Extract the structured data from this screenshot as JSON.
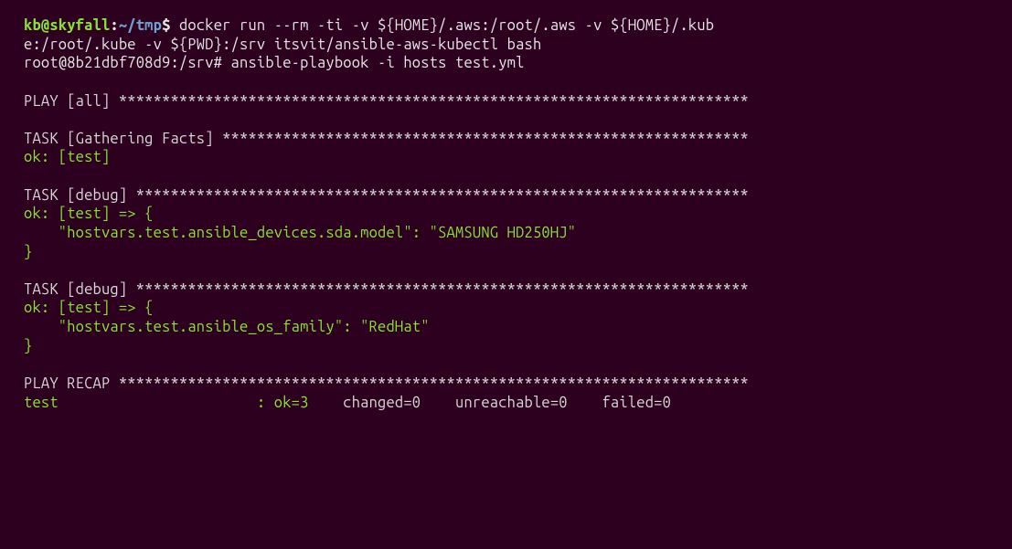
{
  "prompt1": {
    "user": "kb@skyfall",
    "sep": ":",
    "path": "~/tmp",
    "dollar": "$ ",
    "cmd_line1": "docker run --rm -ti -v ${HOME}/.aws:/root/.aws -v ${HOME}/.kub",
    "cmd_line2": "e:/root/.kube -v ${PWD}:/srv itsvit/ansible-aws-kubectl bash"
  },
  "prompt2": "root@8b21dbf708d9:/srv# ansible-playbook -i hosts test.yml",
  "play_all": "PLAY [all] *************************************************************************",
  "task_facts": "TASK [Gathering Facts] *************************************************************",
  "ok_facts": "ok: [test]",
  "task_debug1": "TASK [debug] ***********************************************************************",
  "ok_debug1_l1": "ok: [test] => {",
  "ok_debug1_l2": "    \"hostvars.test.ansible_devices.sda.model\": \"SAMSUNG HD250HJ\"",
  "ok_debug1_l3": "}",
  "task_debug2": "TASK [debug] ***********************************************************************",
  "ok_debug2_l1": "ok: [test] => {",
  "ok_debug2_l2": "    \"hostvars.test.ansible_os_family\": \"RedHat\"",
  "ok_debug2_l3": "}",
  "recap_head": "PLAY RECAP *************************************************************************",
  "recap_host": "test                       : ",
  "recap_ok": "ok=3",
  "recap_rest": "    changed=0    unreachable=0    failed=0"
}
